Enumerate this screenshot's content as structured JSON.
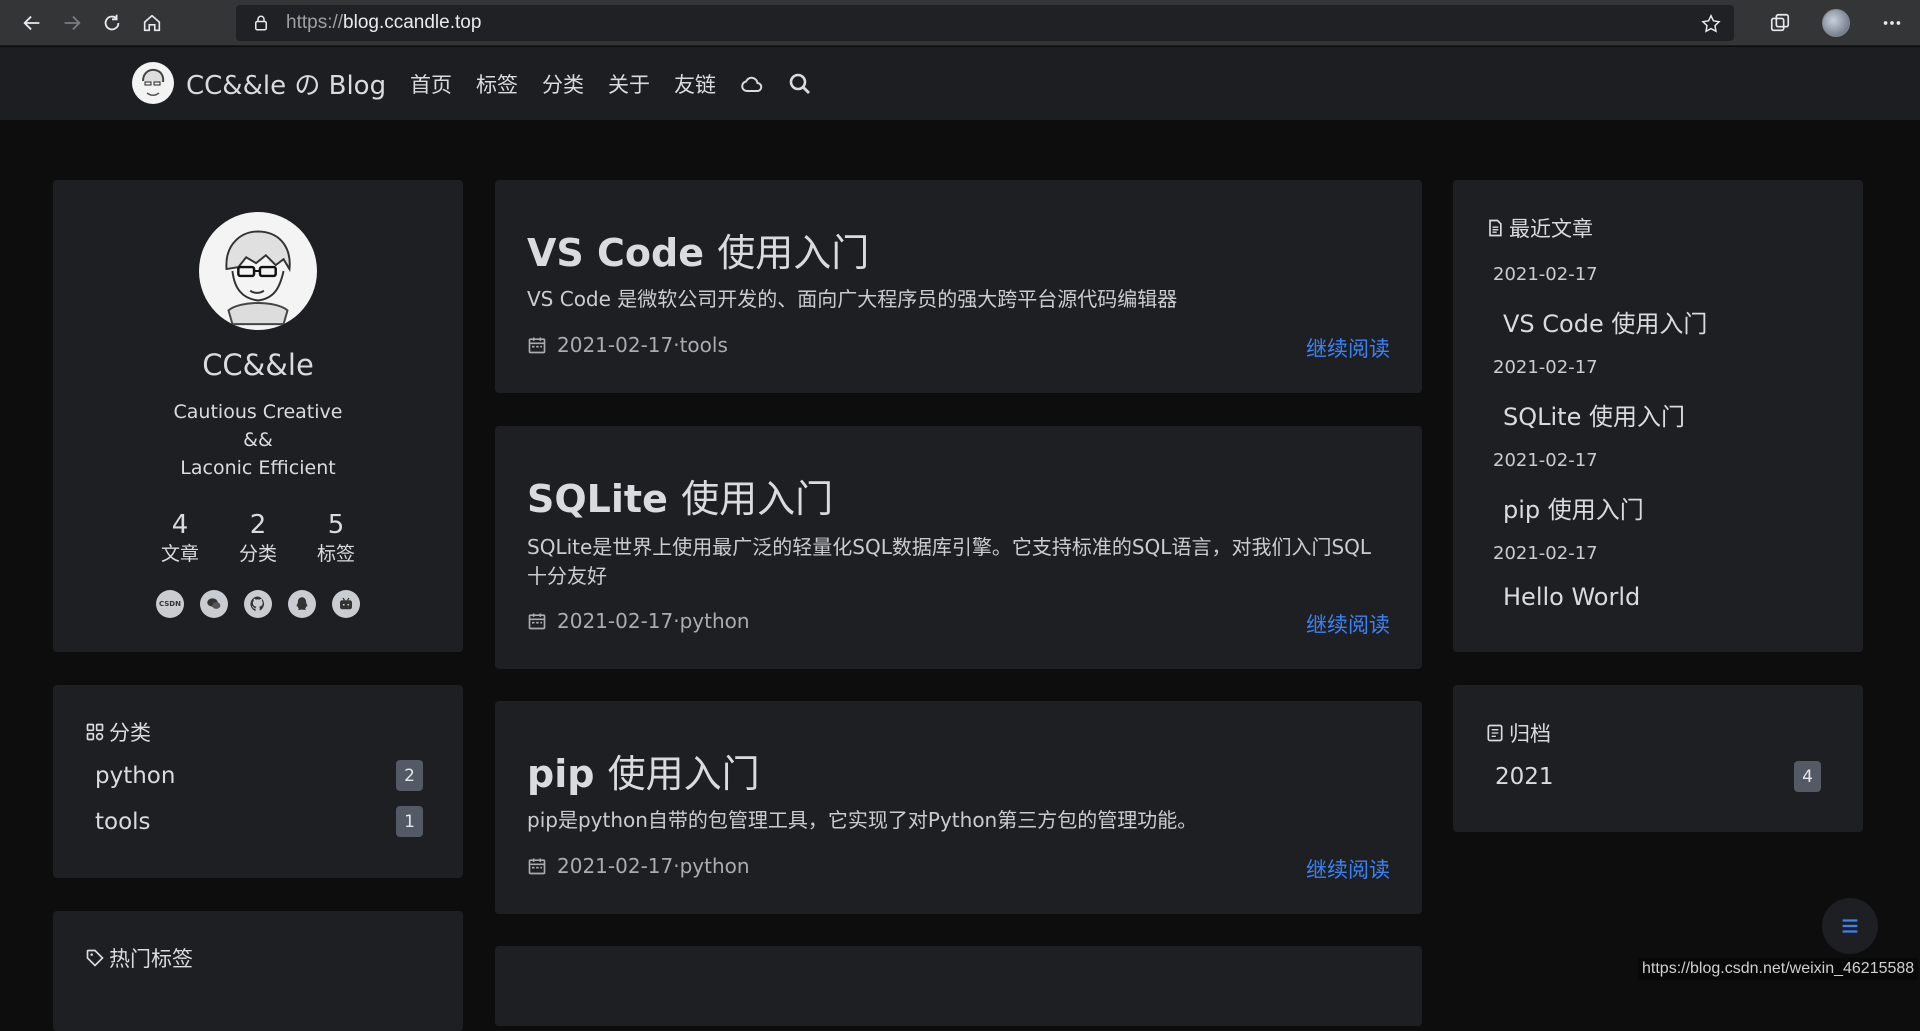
{
  "browser": {
    "url_scheme": "https://",
    "url_host": "blog.ccandle.top"
  },
  "site": {
    "brand": "CC&&le の Blog",
    "nav": [
      "首页",
      "标签",
      "分类",
      "关于",
      "友链"
    ]
  },
  "profile": {
    "name": "CC&&le",
    "bio": [
      "Cautious Creative",
      "&&",
      "Laconic Efficient"
    ],
    "stats": [
      {
        "num": "4",
        "label": "文章"
      },
      {
        "num": "2",
        "label": "分类"
      },
      {
        "num": "5",
        "label": "标签"
      }
    ],
    "social_icons": [
      "csdn-icon",
      "wechat-icon",
      "github-icon",
      "qq-icon",
      "bilibili-icon"
    ],
    "csdn_text": "CSDN"
  },
  "categories": {
    "title": "分类",
    "items": [
      {
        "name": "python",
        "count": "2"
      },
      {
        "name": "tools",
        "count": "1"
      }
    ]
  },
  "tags": {
    "title": "热门标签"
  },
  "posts": [
    {
      "title_en": "VS Code ",
      "title_cn": "使用入门",
      "desc": "VS Code 是微软公司开发的、面向广大程序员的强大跨平台源代码编辑器",
      "date": "2021-02-17",
      "category": "tools",
      "read_more": "继续阅读"
    },
    {
      "title_en": "SQLite ",
      "title_cn": "使用入门",
      "desc": "SQLite是世界上使用最广泛的轻量化SQL数据库引擎。它支持标准的SQL语言，对我们入门SQL十分友好",
      "date": "2021-02-17",
      "category": "python",
      "read_more": "继续阅读"
    },
    {
      "title_en": "pip ",
      "title_cn": "使用入门",
      "desc": "pip是python自带的包管理工具，它实现了对Python第三方包的管理功能。",
      "date": "2021-02-17",
      "category": "python",
      "read_more": "继续阅读"
    }
  ],
  "recent": {
    "title": "最近文章",
    "items": [
      {
        "date": "2021-02-17",
        "title": "VS Code 使用入门"
      },
      {
        "date": "2021-02-17",
        "title": "SQLite 使用入门"
      },
      {
        "date": "2021-02-17",
        "title": "pip 使用入门"
      },
      {
        "date": "2021-02-17",
        "title": "Hello World"
      }
    ]
  },
  "archive": {
    "title": "归档",
    "items": [
      {
        "year": "2021",
        "count": "4"
      }
    ]
  },
  "meta_separator": " · ",
  "watermark": "https://blog.csdn.net/weixin_46215588",
  "colors": {
    "link": "#3b82f6",
    "card": "#1e1f22",
    "background": "#0d0d0e"
  }
}
